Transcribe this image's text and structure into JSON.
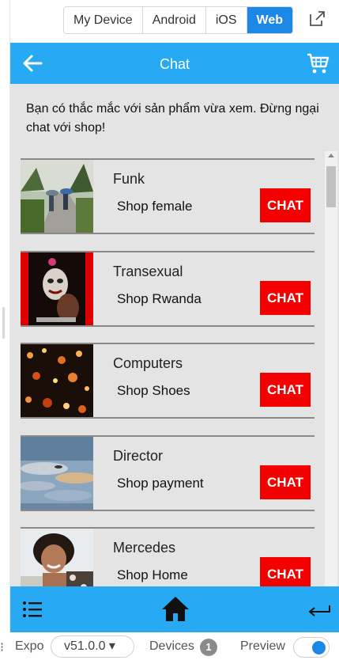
{
  "switcher": {
    "tabs": [
      "My Device",
      "Android",
      "iOS",
      "Web"
    ],
    "active": "Web"
  },
  "header": {
    "title": "Chat"
  },
  "intro_text": "Bạn có thắc mắc với sản phẩm vừa xem. Đừng ngại chat với shop!",
  "items": [
    {
      "name": "Funk",
      "shop": "Shop female",
      "button": "CHAT",
      "thumb_icon": "park-path-photo"
    },
    {
      "name": "Transexual",
      "shop": "Shop Rwanda",
      "button": "CHAT",
      "thumb_icon": "masked-performer-photo"
    },
    {
      "name": "Computers",
      "shop": "Shop Shoes",
      "button": "CHAT",
      "thumb_icon": "bokeh-lights-photo"
    },
    {
      "name": "Director",
      "shop": "Shop payment",
      "button": "CHAT",
      "thumb_icon": "cloudy-sky-photo"
    },
    {
      "name": "Mercedes",
      "shop": "Shop Home",
      "button": "CHAT",
      "thumb_icon": "smiling-woman-photo"
    }
  ],
  "tabbar": {
    "icons": [
      "menu-icon",
      "home-icon",
      "return-icon"
    ]
  },
  "bottom": {
    "dots": "⁝",
    "expo_label": "Expo",
    "version": "v51.0.0 ▾",
    "devices_label": "Devices",
    "devices_count": "1",
    "preview_label": "Preview"
  },
  "colors": {
    "header": "#27a9f3",
    "chat_button": "#f50000",
    "active_tab": "#1b87e6",
    "content_bg": "#e4e4e4"
  }
}
